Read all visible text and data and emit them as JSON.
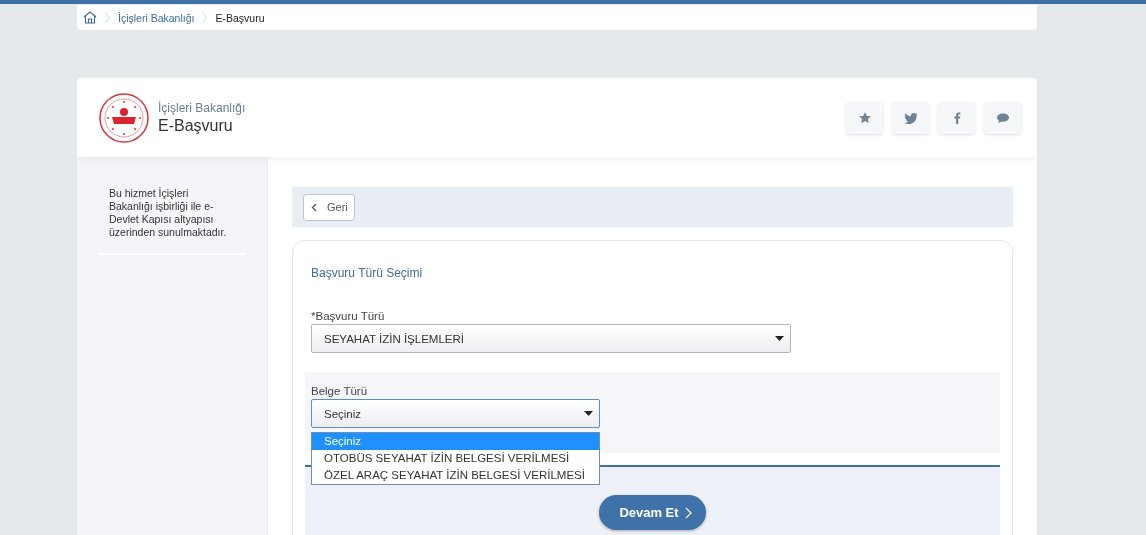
{
  "breadcrumb": {
    "items": [
      {
        "label": "İçişleri Bakanlığı",
        "current": false
      },
      {
        "label": "E-Başvuru",
        "current": true
      }
    ]
  },
  "header": {
    "ministry": "İçişleri Bakanlığı",
    "title": "E-Başvuru",
    "actions": [
      {
        "kind": "star"
      },
      {
        "kind": "twitter"
      },
      {
        "kind": "facebook"
      },
      {
        "kind": "chat"
      }
    ]
  },
  "sidebar": {
    "note": "Bu hizmet İçişleri Bakanlığı işbirliği ile e-Devlet Kapısı altyapısı üzerinden sunulmaktadır."
  },
  "back_button": {
    "label": "Geri"
  },
  "form": {
    "title": "Başvuru Türü Seçimi",
    "application_type": {
      "label": "*Başvuru Türü",
      "value": "SEYAHAT İZİN İŞLEMLERİ"
    },
    "document_type": {
      "label": "Belge Türü",
      "value": "Seçiniz",
      "expanded": true,
      "options": [
        {
          "label": "Seçiniz",
          "selected": true
        },
        {
          "label": "OTOBÜS SEYAHAT İZİN BELGESİ VERİLMESİ",
          "selected": false
        },
        {
          "label": "ÖZEL ARAÇ SEYAHAT İZİN BELGESİ VERİLMESİ",
          "selected": false
        }
      ]
    },
    "submit": {
      "label": "Devam Et"
    }
  }
}
